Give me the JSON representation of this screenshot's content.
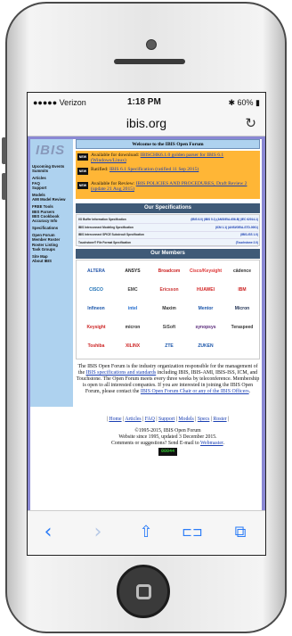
{
  "status": {
    "carrier": "●●●●● Verizon",
    "time": "1:18 PM",
    "battery": "60%"
  },
  "browser": {
    "url": "ibis.org"
  },
  "sidebar": {
    "logo": "IBIS",
    "items": [
      "Upcoming Events",
      "Summits",
      "",
      "Articles",
      "FAQ",
      "Support",
      "",
      "Models",
      "AMI Model Review",
      "",
      "FREE Tools",
      "IBIS Parsers",
      "IBIS Cookbook",
      "Accuracy Info",
      "",
      "Specifications",
      "",
      "Open Forum",
      "Member Roster",
      "Roster Listing",
      "Task Groups",
      "",
      "Site Map",
      "About IBIS"
    ]
  },
  "main": {
    "banner": "Welcome to the IBIS Open Forum",
    "news": [
      {
        "tag": "NEW",
        "prefix": "Available for download: ",
        "link": "IBISCHK6.1.0 golden parser for IBIS 6.1 (Windows/Linux)",
        "suffix": ""
      },
      {
        "tag": "NEW",
        "prefix": "Ratified: ",
        "link": "IBIS 6.1 Specification (ratified 11 Sep 2015)",
        "suffix": ""
      },
      {
        "tag": "NEW",
        "prefix": "Available for Review: ",
        "link": "IBIS POLICIES AND PROCEDURES, Draft Review 2 (update 21 Aug 2015)",
        "suffix": ""
      }
    ],
    "specs_title": "Our Specifications",
    "specs": [
      {
        "name": "I/O Buffer Information Specification",
        "links": "(IBIS 6.0) (IBIS 5.1) (ANSI/EIA-656-B) (IEC 62014-1)"
      },
      {
        "name": "IBIS Interconnect Modeling Specification",
        "links": "(ICM 1.1) (ANSI/GEIA-STD-0001)"
      },
      {
        "name": "IBIS Interconnect SPICE Subcircuit Specification",
        "links": "(IBIS-ISS 1.0)"
      },
      {
        "name": "Touchstone® File Format Specification",
        "links": "(Touchstone 2.0)"
      }
    ],
    "members_title": "Our Members",
    "members": [
      {
        "name": "ALTERA",
        "color": "#2255aa"
      },
      {
        "name": "ANSYS",
        "color": "#222222"
      },
      {
        "name": "Broadcom",
        "color": "#cc2222"
      },
      {
        "name": "Cisco/Keysight",
        "color": "#dd3333"
      },
      {
        "name": "cādence",
        "color": "#333333"
      },
      {
        "name": "CISCO",
        "color": "#1b6fb5"
      },
      {
        "name": "EMC",
        "color": "#444444"
      },
      {
        "name": "Ericsson",
        "color": "#cc3333"
      },
      {
        "name": "HUAWEI",
        "color": "#d22222"
      },
      {
        "name": "IBM",
        "color": "#cc2222"
      },
      {
        "name": "Infineon",
        "color": "#1a55aa"
      },
      {
        "name": "intel",
        "color": "#1a66cc"
      },
      {
        "name": "Maxim",
        "color": "#333333"
      },
      {
        "name": "Mentor",
        "color": "#1a55aa"
      },
      {
        "name": "Micron",
        "color": "#223355"
      },
      {
        "name": "Keysight",
        "color": "#cc2222"
      },
      {
        "name": "micron",
        "color": "#333333"
      },
      {
        "name": "SiSoft",
        "color": "#444444"
      },
      {
        "name": "synopsys",
        "color": "#5a2a7a"
      },
      {
        "name": "Teraspeed",
        "color": "#333333"
      },
      {
        "name": "Toshiba",
        "color": "#cc2222"
      },
      {
        "name": "XILINX",
        "color": "#cc2222"
      },
      {
        "name": "ZTE",
        "color": "#1a55aa"
      },
      {
        "name": "ZUKEN",
        "color": "#1a55aa"
      }
    ],
    "about": [
      {
        "t": "The IBIS Open Forum is the industry organization responsible for the management of the "
      },
      {
        "a": "IBIS specifications and standards"
      },
      {
        "t": " including IBIS, IBIS-AMI, IBIS-ISS, ICM, and Touchstone. The Open Forum meets every three weeks by teleconference. Membership is open to all interested companies. If you are interested in joining the IBIS Open Forum, please contact the "
      },
      {
        "a": "IBIS Open Forum Chair or any of the IBIS Officers"
      },
      {
        "t": "."
      }
    ],
    "links": [
      "Home",
      "Articles",
      "FAQ",
      "Support",
      "Models",
      "Specs",
      "Roster"
    ],
    "footer": {
      "copyright": "©1995-2015, IBIS Open Forum",
      "website": "Website since 1995, updated 3 December 2015.",
      "comments_prefix": "Comments or suggestions? Send E-mail to ",
      "webmaster": "Webmaster",
      "counter": "00044"
    }
  },
  "toolbar": {
    "back": "‹",
    "forward": "›",
    "share": "⇧",
    "bookmarks": "⊏⊐",
    "tabs": "⧉"
  }
}
